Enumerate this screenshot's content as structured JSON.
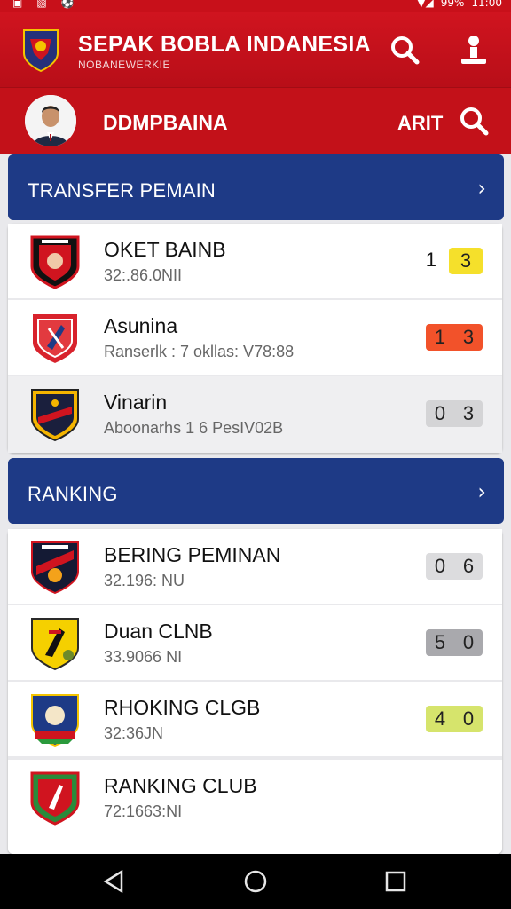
{
  "colors": {
    "brand_red": "#c8101a",
    "section_blue": "#1e3a86"
  },
  "status": {
    "battery": "99%",
    "time": "11:00"
  },
  "header": {
    "title": "SEPAK BOBLA INDANESIA",
    "subtitle": "NOBANEWERKIE",
    "icons": [
      "search-icon",
      "user-icon"
    ]
  },
  "subheader": {
    "title": "DDMPBAINA",
    "action": "ARIT",
    "icons": [
      "avatar",
      "search-icon"
    ]
  },
  "transfer": {
    "title": "TRANSFER PEMAIN",
    "items": [
      {
        "name": "OKET BAINB",
        "meta": "32:.86.0NII",
        "solo": "1",
        "score": [
          "",
          "3"
        ],
        "score_bg": "#f5e02b"
      },
      {
        "name": "Asunina",
        "meta": "Ranserlk : 7 okllas: V78:88",
        "score": [
          "1",
          "3"
        ],
        "score_bg": "#f2522a"
      },
      {
        "name": "Vinarin",
        "meta": "Aboonarhs 1 6 PesIV02B",
        "score": [
          "0",
          "3"
        ],
        "score_bg": "#d4d4d6"
      }
    ]
  },
  "ranking": {
    "title": "RANKING",
    "items": [
      {
        "name": "BERING PEMINAN",
        "meta": "32.196: NU",
        "score": [
          "0",
          "6"
        ],
        "score_bg": "#dcdcde"
      },
      {
        "name": "Duan CLNB",
        "meta": "33.9066 NI",
        "score": [
          "5",
          "0"
        ],
        "score_bg": "#a9a9ad"
      },
      {
        "name": "RHOKING CLGB",
        "meta": "32:36JN",
        "score": [
          "4",
          "0"
        ],
        "score_bg": "#d6e46c"
      },
      {
        "name": "RANKING CLUB",
        "meta": "72:1663:NI",
        "score": null
      }
    ]
  }
}
